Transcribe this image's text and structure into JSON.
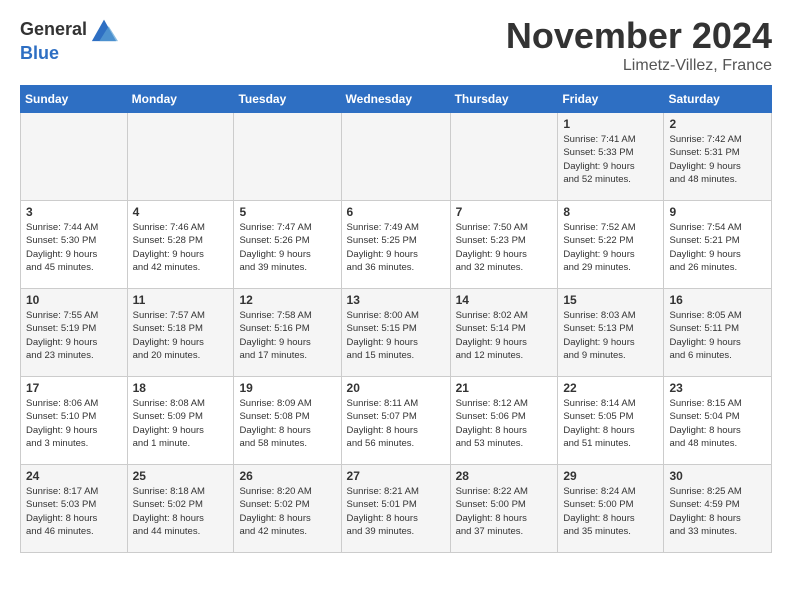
{
  "header": {
    "logo": {
      "general": "General",
      "blue": "Blue"
    },
    "title": "November 2024",
    "location": "Limetz-Villez, France"
  },
  "days_of_week": [
    "Sunday",
    "Monday",
    "Tuesday",
    "Wednesday",
    "Thursday",
    "Friday",
    "Saturday"
  ],
  "weeks": [
    [
      {
        "day": "",
        "info": ""
      },
      {
        "day": "",
        "info": ""
      },
      {
        "day": "",
        "info": ""
      },
      {
        "day": "",
        "info": ""
      },
      {
        "day": "",
        "info": ""
      },
      {
        "day": "1",
        "info": "Sunrise: 7:41 AM\nSunset: 5:33 PM\nDaylight: 9 hours\nand 52 minutes."
      },
      {
        "day": "2",
        "info": "Sunrise: 7:42 AM\nSunset: 5:31 PM\nDaylight: 9 hours\nand 48 minutes."
      }
    ],
    [
      {
        "day": "3",
        "info": "Sunrise: 7:44 AM\nSunset: 5:30 PM\nDaylight: 9 hours\nand 45 minutes."
      },
      {
        "day": "4",
        "info": "Sunrise: 7:46 AM\nSunset: 5:28 PM\nDaylight: 9 hours\nand 42 minutes."
      },
      {
        "day": "5",
        "info": "Sunrise: 7:47 AM\nSunset: 5:26 PM\nDaylight: 9 hours\nand 39 minutes."
      },
      {
        "day": "6",
        "info": "Sunrise: 7:49 AM\nSunset: 5:25 PM\nDaylight: 9 hours\nand 36 minutes."
      },
      {
        "day": "7",
        "info": "Sunrise: 7:50 AM\nSunset: 5:23 PM\nDaylight: 9 hours\nand 32 minutes."
      },
      {
        "day": "8",
        "info": "Sunrise: 7:52 AM\nSunset: 5:22 PM\nDaylight: 9 hours\nand 29 minutes."
      },
      {
        "day": "9",
        "info": "Sunrise: 7:54 AM\nSunset: 5:21 PM\nDaylight: 9 hours\nand 26 minutes."
      }
    ],
    [
      {
        "day": "10",
        "info": "Sunrise: 7:55 AM\nSunset: 5:19 PM\nDaylight: 9 hours\nand 23 minutes."
      },
      {
        "day": "11",
        "info": "Sunrise: 7:57 AM\nSunset: 5:18 PM\nDaylight: 9 hours\nand 20 minutes."
      },
      {
        "day": "12",
        "info": "Sunrise: 7:58 AM\nSunset: 5:16 PM\nDaylight: 9 hours\nand 17 minutes."
      },
      {
        "day": "13",
        "info": "Sunrise: 8:00 AM\nSunset: 5:15 PM\nDaylight: 9 hours\nand 15 minutes."
      },
      {
        "day": "14",
        "info": "Sunrise: 8:02 AM\nSunset: 5:14 PM\nDaylight: 9 hours\nand 12 minutes."
      },
      {
        "day": "15",
        "info": "Sunrise: 8:03 AM\nSunset: 5:13 PM\nDaylight: 9 hours\nand 9 minutes."
      },
      {
        "day": "16",
        "info": "Sunrise: 8:05 AM\nSunset: 5:11 PM\nDaylight: 9 hours\nand 6 minutes."
      }
    ],
    [
      {
        "day": "17",
        "info": "Sunrise: 8:06 AM\nSunset: 5:10 PM\nDaylight: 9 hours\nand 3 minutes."
      },
      {
        "day": "18",
        "info": "Sunrise: 8:08 AM\nSunset: 5:09 PM\nDaylight: 9 hours\nand 1 minute."
      },
      {
        "day": "19",
        "info": "Sunrise: 8:09 AM\nSunset: 5:08 PM\nDaylight: 8 hours\nand 58 minutes."
      },
      {
        "day": "20",
        "info": "Sunrise: 8:11 AM\nSunset: 5:07 PM\nDaylight: 8 hours\nand 56 minutes."
      },
      {
        "day": "21",
        "info": "Sunrise: 8:12 AM\nSunset: 5:06 PM\nDaylight: 8 hours\nand 53 minutes."
      },
      {
        "day": "22",
        "info": "Sunrise: 8:14 AM\nSunset: 5:05 PM\nDaylight: 8 hours\nand 51 minutes."
      },
      {
        "day": "23",
        "info": "Sunrise: 8:15 AM\nSunset: 5:04 PM\nDaylight: 8 hours\nand 48 minutes."
      }
    ],
    [
      {
        "day": "24",
        "info": "Sunrise: 8:17 AM\nSunset: 5:03 PM\nDaylight: 8 hours\nand 46 minutes."
      },
      {
        "day": "25",
        "info": "Sunrise: 8:18 AM\nSunset: 5:02 PM\nDaylight: 8 hours\nand 44 minutes."
      },
      {
        "day": "26",
        "info": "Sunrise: 8:20 AM\nSunset: 5:02 PM\nDaylight: 8 hours\nand 42 minutes."
      },
      {
        "day": "27",
        "info": "Sunrise: 8:21 AM\nSunset: 5:01 PM\nDaylight: 8 hours\nand 39 minutes."
      },
      {
        "day": "28",
        "info": "Sunrise: 8:22 AM\nSunset: 5:00 PM\nDaylight: 8 hours\nand 37 minutes."
      },
      {
        "day": "29",
        "info": "Sunrise: 8:24 AM\nSunset: 5:00 PM\nDaylight: 8 hours\nand 35 minutes."
      },
      {
        "day": "30",
        "info": "Sunrise: 8:25 AM\nSunset: 4:59 PM\nDaylight: 8 hours\nand 33 minutes."
      }
    ]
  ]
}
